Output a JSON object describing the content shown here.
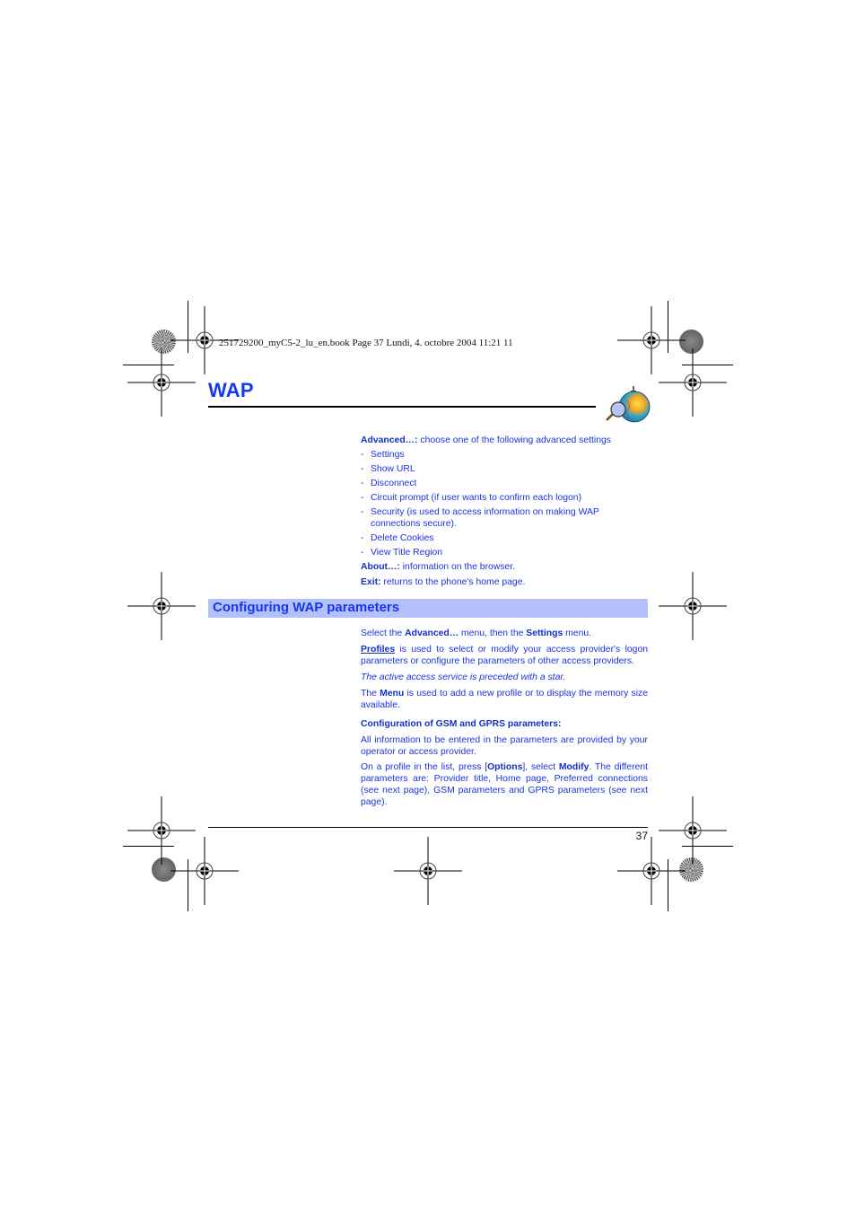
{
  "print_header": "251729200_myC5-2_lu_en.book  Page 37  Lundi, 4. octobre 2004  11:21 11",
  "chapter": {
    "title": "WAP",
    "icon": "globe-magnifier-icon"
  },
  "advanced": {
    "label": "Advanced…:",
    "text": " choose one of the following advanced settings",
    "items": [
      "Settings",
      "Show URL",
      "Disconnect",
      "Circuit prompt (if user wants to confirm each logon)",
      "Security (is used to access information on making WAP connections secure).",
      "Delete Cookies",
      "View Title Region"
    ],
    "bullet": "-"
  },
  "about": {
    "label": "About…:",
    "text": " information on the browser."
  },
  "exit": {
    "label": "Exit:",
    "text": " returns to the phone's home page."
  },
  "section": {
    "title": "Configuring WAP parameters",
    "p1": {
      "a": "Select the ",
      "b1": "Advanced…",
      "c": " menu, then the ",
      "b2": "Settings",
      "d": " menu."
    },
    "p2": {
      "link": "Profiles",
      "text": " is used to select or modify your access provider's logon parameters or configure the parameters of other access providers."
    },
    "p3": "The active access service is preceded with a star.",
    "p4": {
      "a": "The ",
      "b": "Menu",
      "c": " is used to add a new profile or to display the memory size available."
    },
    "subheading": "Configuration of GSM and GPRS parameters:",
    "p5": "All information to be entered in the parameters are provided by your operator or access provider.",
    "p6": {
      "a": "On a profile in the list, press [",
      "b1": "Options",
      "c": "], select ",
      "b2": "Modify",
      "d": ". The different parameters are: Provider title, Home page, Preferred connections (see next page), GSM parameters and GPRS parameters (see next page)."
    }
  },
  "footer": {
    "page_number": "37"
  },
  "colors": {
    "text_blue": "#1a33e0",
    "title_blue": "#1437f0",
    "section_bar": "#b3c0fa"
  }
}
